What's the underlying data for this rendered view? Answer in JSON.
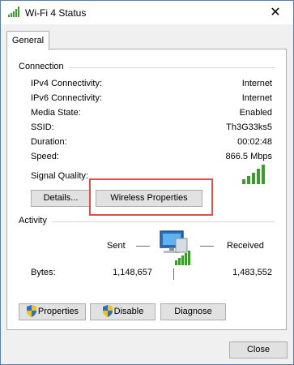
{
  "window": {
    "title": "Wi-Fi 4 Status",
    "close_glyph": "✕"
  },
  "tabs": [
    {
      "label": "General"
    }
  ],
  "connection": {
    "group_label": "Connection",
    "rows": [
      {
        "label": "IPv4 Connectivity:",
        "value": "Internet"
      },
      {
        "label": "IPv6 Connectivity:",
        "value": "Internet"
      },
      {
        "label": "Media State:",
        "value": "Enabled"
      },
      {
        "label": "SSID:",
        "value": "Th3G33ks5"
      },
      {
        "label": "Duration:",
        "value": "00:02:48"
      },
      {
        "label": "Speed:",
        "value": "866.5 Mbps"
      }
    ],
    "signal_label": "Signal Quality:",
    "signal_bars": 5,
    "details_button": "Details...",
    "wireless_button": "Wireless Properties"
  },
  "activity": {
    "group_label": "Activity",
    "sent_label": "Sent",
    "received_label": "Received",
    "bytes_label": "Bytes:",
    "bytes_sent": "1,148,657",
    "bytes_received": "1,483,552"
  },
  "buttons": {
    "properties": "Properties",
    "disable": "Disable",
    "diagnose": "Diagnose",
    "close": "Close"
  },
  "colors": {
    "accent_highlight": "#d9534f",
    "signal_green": "#3c9a2e"
  },
  "icons": [
    "wifi-signal-icon",
    "close-icon",
    "network-computer-icon",
    "uac-shield-icon"
  ]
}
